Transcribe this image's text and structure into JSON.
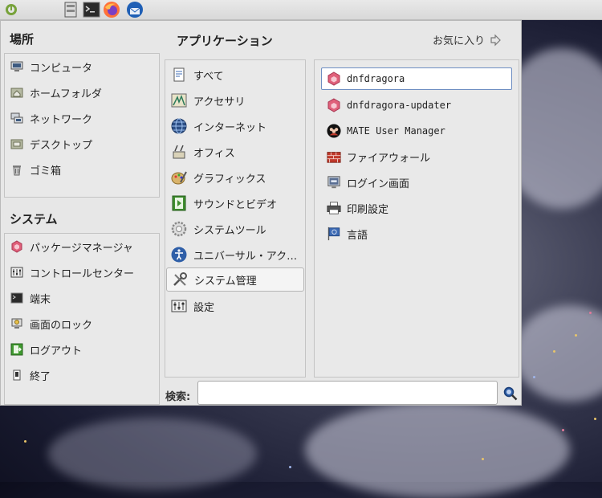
{
  "panel": {
    "icons": [
      "mate-logo-icon",
      "file-manager-icon",
      "terminal-icon",
      "firefox-icon",
      "thunderbird-icon"
    ]
  },
  "places": {
    "heading": "場所",
    "items": [
      {
        "label": "コンピュータ",
        "icon": "computer-icon"
      },
      {
        "label": "ホームフォルダ",
        "icon": "home-folder-icon"
      },
      {
        "label": "ネットワーク",
        "icon": "network-icon"
      },
      {
        "label": "デスクトップ",
        "icon": "desktop-folder-icon"
      },
      {
        "label": "ゴミ箱",
        "icon": "trash-icon"
      }
    ]
  },
  "system": {
    "heading": "システム",
    "items": [
      {
        "label": "パッケージマネージャ",
        "icon": "package-icon"
      },
      {
        "label": "コントロールセンター",
        "icon": "control-center-icon"
      },
      {
        "label": "端末",
        "icon": "terminal-icon"
      },
      {
        "label": "画面のロック",
        "icon": "lock-screen-icon"
      },
      {
        "label": "ログアウト",
        "icon": "logout-icon"
      },
      {
        "label": "終了",
        "icon": "shutdown-icon"
      }
    ]
  },
  "applications": {
    "heading": "アプリケーション",
    "favorites_label": "お気に入り",
    "categories": [
      {
        "label": "すべて",
        "icon": "all-apps-icon"
      },
      {
        "label": "アクセサリ",
        "icon": "accessories-icon"
      },
      {
        "label": "インターネット",
        "icon": "internet-globe-icon"
      },
      {
        "label": "オフィス",
        "icon": "office-icon"
      },
      {
        "label": "グラフィックス",
        "icon": "graphics-icon"
      },
      {
        "label": "サウンドとビデオ",
        "icon": "multimedia-icon"
      },
      {
        "label": "システムツール",
        "icon": "system-tools-gear-icon"
      },
      {
        "label": "ユニバーサル・アク…",
        "icon": "accessibility-icon"
      },
      {
        "label": "システム管理",
        "icon": "administration-tools-icon",
        "selected": true
      },
      {
        "label": "設定",
        "icon": "settings-icon"
      }
    ],
    "apps": [
      {
        "label": "dnfdragora",
        "icon": "dnfdragora-icon",
        "selected": true
      },
      {
        "label": "dnfdragora-updater",
        "icon": "dnfdragora-icon"
      },
      {
        "label": "MATE User Manager",
        "icon": "users-icon"
      },
      {
        "label": "ファイアウォール",
        "icon": "firewall-icon"
      },
      {
        "label": "ログイン画面",
        "icon": "login-screen-icon"
      },
      {
        "label": "印刷設定",
        "icon": "printer-icon"
      },
      {
        "label": "言語",
        "icon": "language-flag-icon"
      }
    ]
  },
  "search": {
    "label": "検索:",
    "value": ""
  }
}
